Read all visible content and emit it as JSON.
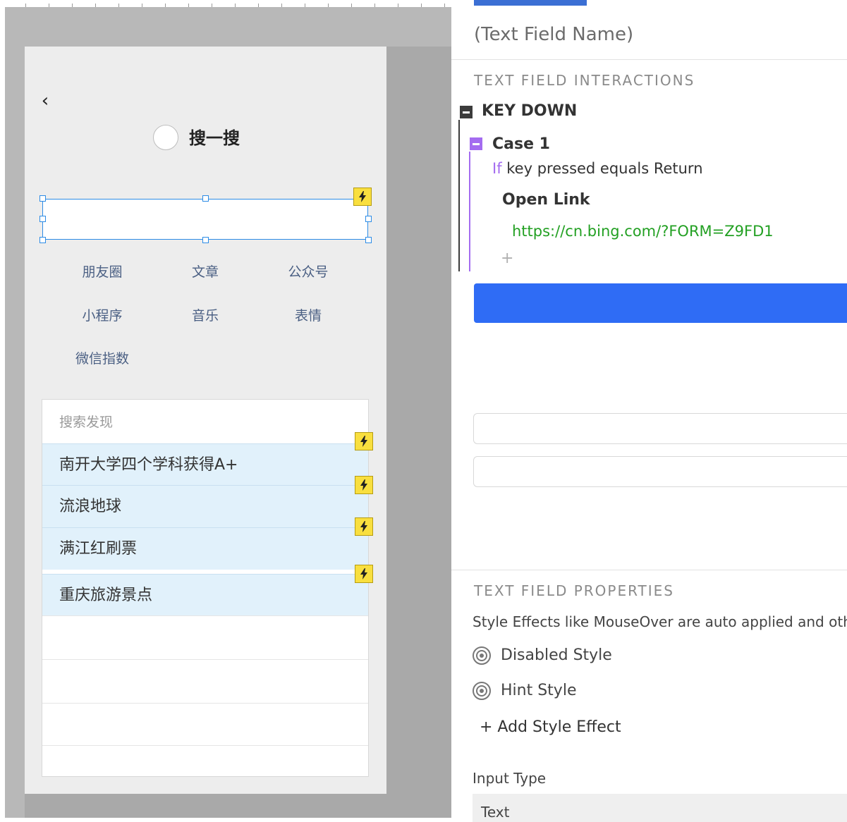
{
  "canvas": {
    "back_glyph": "‹",
    "title": "搜一搜",
    "search_value": "",
    "categories": [
      "朋友圈",
      "文章",
      "公众号",
      "小程序",
      "音乐",
      "表情",
      "微信指数"
    ],
    "discover": {
      "header": "搜索发现",
      "items": [
        "南开大学四个学科获得A+",
        "流浪地球",
        "满江红刷票",
        "重庆旅游景点"
      ]
    },
    "interaction_marker_icon": "lightning-bolt-icon"
  },
  "panel": {
    "field_name": "(Text Field Name)",
    "interactions_title": "TEXT FIELD INTERACTIONS",
    "event": "KEY DOWN",
    "case": "Case 1",
    "condition_if": "If",
    "condition_text": " key pressed equals Return",
    "action": "Open Link",
    "action_url": "https://cn.bing.com/?FORM=Z9FD1",
    "add_action": "+",
    "properties_title": "TEXT FIELD PROPERTIES",
    "properties_desc": "Style Effects like MouseOver are auto applied and others",
    "style_effects": [
      "Disabled Style",
      "Hint Style"
    ],
    "add_style": "+ Add Style Effect",
    "input_type_label": "Input Type",
    "input_type_value": "Text"
  },
  "colors": {
    "accent_blue": "#2f6cf5",
    "selection_blue": "#2d8ce6",
    "case_purple": "#a46cf0",
    "url_green": "#23a023",
    "marker_yellow": "#f9df3f",
    "highlight_row": "#e1f1fb"
  }
}
